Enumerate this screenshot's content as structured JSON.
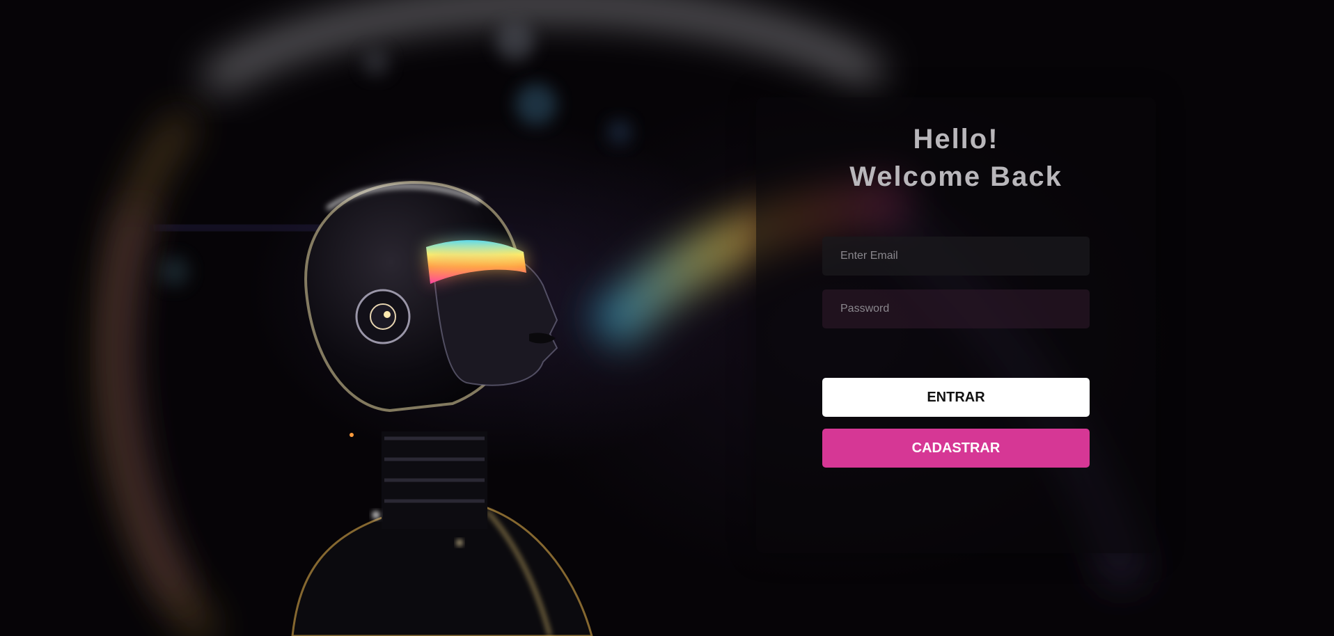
{
  "login": {
    "title_line1": "Hello!",
    "title_line2": "Welcome Back",
    "email_placeholder": "Enter Email",
    "password_placeholder": "Password",
    "enter_label": "ENTRAR",
    "register_label": "CADASTRAR"
  },
  "colors": {
    "accent": "#d63795",
    "primary_button": "#ffffff",
    "title_text": "#b9b7bb"
  }
}
